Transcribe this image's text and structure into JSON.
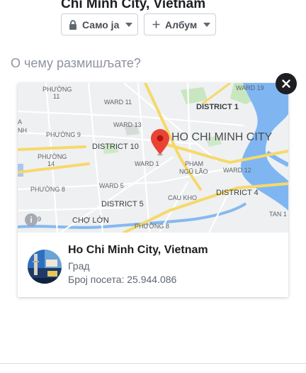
{
  "composer": {
    "location_title": "Chi Minh City, Vietnam",
    "privacy_label": "Само ја",
    "album_label": "Албум",
    "placeholder": "О чему размишљате?"
  },
  "map": {
    "labels": {
      "phuong11": "PHƯỜNG",
      "phuong11b": "11",
      "ward19": "WARD 19",
      "ward11": "WARD 11",
      "district1": "DISTRICT 1",
      "ward13": "WARD 13",
      "aa": "A",
      "nh": "NH",
      "phuong9": "PHƯỜNG 9",
      "district10": "DISTRICT 10",
      "city": "HO CHI MINH CITY",
      "phuong14": "PHƯỜNG",
      "phuong14b": "14",
      "ward1": "WARD 1",
      "pham": "PHAM",
      "ngulao": "NGŨ LÃO",
      "ward12": "WARD 12",
      "ward5": "WARD 5",
      "phuong8a": "PHƯỜNG 8",
      "caukho": "CAU KHO",
      "district5": "DISTRICT 5",
      "district4": "DISTRICT 4",
      "tan1": "TAN 1",
      "nine": "9",
      "cholon": "CHỢ LỚN",
      "phuong8b": "PHƯỜNG 8"
    }
  },
  "place": {
    "title": "Ho Chi Minh City, Vietnam",
    "type": "Град",
    "visits": "Број посета: 25.944.086"
  }
}
